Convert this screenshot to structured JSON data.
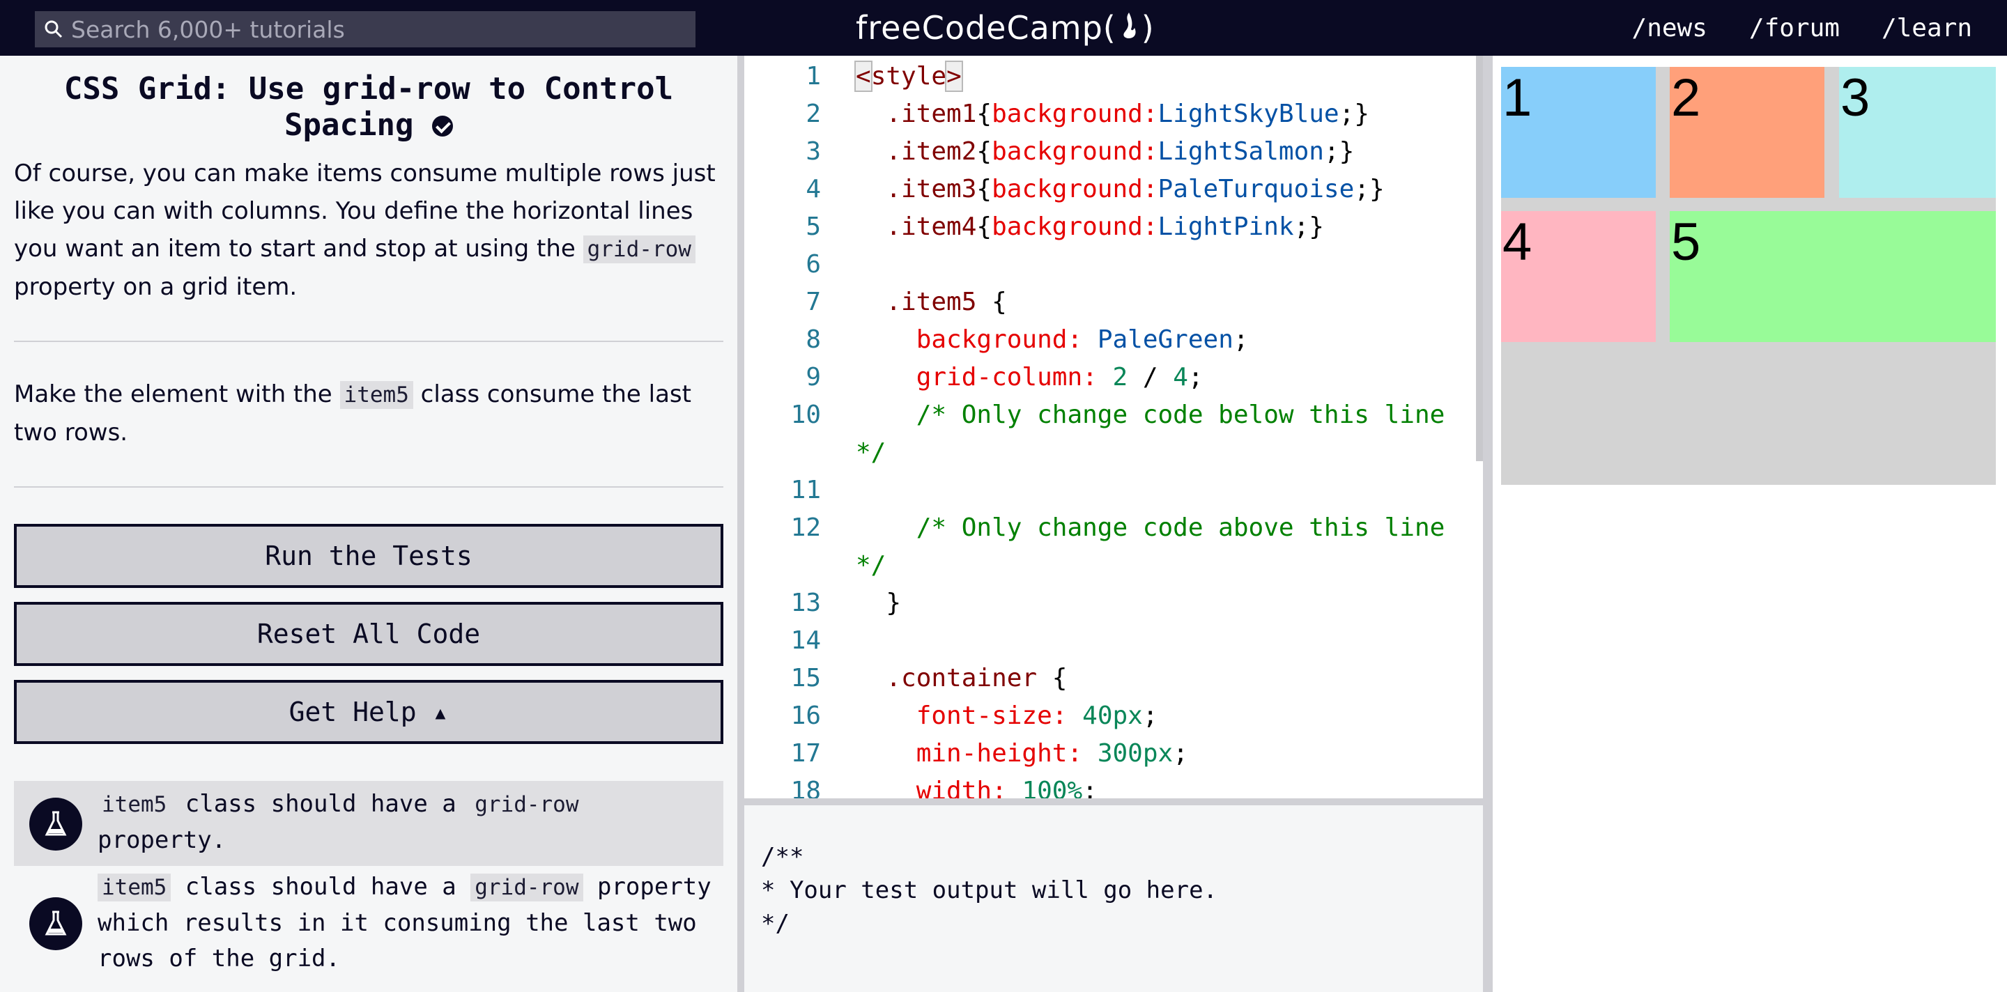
{
  "nav": {
    "search_placeholder": "Search 6,000+ tutorials",
    "logo_text_before": "freeCodeCamp(",
    "logo_text_after": ")",
    "links": [
      "/news",
      "/forum",
      "/learn"
    ]
  },
  "challenge": {
    "title": "CSS Grid: Use grid-row to Control Spacing",
    "desc1_part1": "Of course, you can make items consume multiple rows just like you can with columns. You define the horizontal lines you want an item to start and stop at using the ",
    "desc1_code": "grid-row",
    "desc1_part2": " property on a grid item.",
    "desc2_part1": "Make the element with the ",
    "desc2_code": "item5",
    "desc2_part2": " class consume the last two rows."
  },
  "buttons": {
    "run": "Run the Tests",
    "reset": "Reset All Code",
    "help": "Get Help ▴"
  },
  "tests": [
    {
      "code1": "item5",
      "text1": " class should have a ",
      "code2": "grid-row",
      "text2": " property."
    },
    {
      "code1": "item5",
      "text1": " class should have a ",
      "code2": "grid-row",
      "text2": " property which results in it consuming the last two rows of the grid."
    }
  ],
  "editor": {
    "line_numbers": [
      "1",
      "2",
      "3",
      "4",
      "5",
      "6",
      "7",
      "8",
      "9",
      "10",
      "11",
      "12",
      "13",
      "14",
      "15",
      "16",
      "17",
      "18"
    ],
    "lines": {
      "l1": "style",
      "l2_sel": ".item1",
      "l2_prop": "background:",
      "l2_val": "LightSkyBlue",
      "l3_sel": ".item2",
      "l3_prop": "background:",
      "l3_val": "LightSalmon",
      "l4_sel": ".item3",
      "l4_prop": "background:",
      "l4_val": "PaleTurquoise",
      "l5_sel": ".item4",
      "l5_prop": "background:",
      "l5_val": "LightPink",
      "l7_sel": ".item5",
      "l8_prop": "background:",
      "l8_val": "PaleGreen",
      "l9_prop": "grid-column:",
      "l9_n1": "2",
      "l9_n2": "4",
      "l10_com": "/* Only change code below this line",
      "l10b_com": "*/",
      "l12_com": "/* Only change code above this line",
      "l12b_com": "*/",
      "l15_sel": ".container",
      "l16_prop": "font-size:",
      "l16_val": "40px",
      "l17_prop": "min-height:",
      "l17_val": "300px",
      "l18_prop": "width:",
      "l18_val": "100%"
    }
  },
  "output_text": "/**\n* Your test output will go here.\n*/",
  "preview": {
    "items": [
      {
        "label": "1",
        "color": "#87cefa"
      },
      {
        "label": "2",
        "color": "#ffa07a"
      },
      {
        "label": "3",
        "color": "#afeeee"
      },
      {
        "label": "4",
        "color": "#ffb6c1"
      },
      {
        "label": "5",
        "color": "#98fb98"
      }
    ],
    "container_color": "#d3d3d3"
  }
}
